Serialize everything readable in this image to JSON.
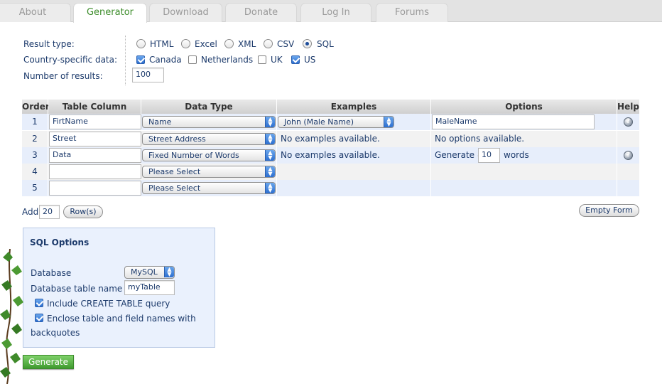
{
  "tabs": [
    "About",
    "Generator",
    "Download",
    "Donate",
    "Log In",
    "Forums"
  ],
  "active_tab": "Generator",
  "settings": {
    "result_type_label": "Result type:",
    "result_types": [
      {
        "label": "HTML",
        "selected": false
      },
      {
        "label": "Excel",
        "selected": false
      },
      {
        "label": "XML",
        "selected": false
      },
      {
        "label": "CSV",
        "selected": false
      },
      {
        "label": "SQL",
        "selected": true
      }
    ],
    "country_label": "Country-specific data:",
    "countries": [
      {
        "label": "Canada",
        "checked": true
      },
      {
        "label": "Netherlands",
        "checked": false
      },
      {
        "label": "UK",
        "checked": false
      },
      {
        "label": "US",
        "checked": true
      }
    ],
    "num_results_label": "Number of results:",
    "num_results": "100"
  },
  "table": {
    "headers": [
      "Order",
      "Table Column",
      "Data Type",
      "Examples",
      "Options",
      "Help"
    ],
    "rows": [
      {
        "order": "1",
        "column": "FirtName",
        "data_type": "Name",
        "example_select": "John (Male Name)",
        "options_input": "MaleName",
        "help": true
      },
      {
        "order": "2",
        "column": "Street",
        "data_type": "Street Address",
        "examples_text": "No examples available.",
        "options_text": "No options available.",
        "help": false
      },
      {
        "order": "3",
        "column": "Data",
        "data_type": "Fixed Number of Words",
        "examples_text": "No examples available.",
        "options_prefix": "Generate #",
        "options_num": "10",
        "options_suffix": "words",
        "help": true
      },
      {
        "order": "4",
        "column": "",
        "data_type": "Please Select",
        "help": false
      },
      {
        "order": "5",
        "column": "",
        "data_type": "Please Select",
        "help": false
      }
    ]
  },
  "add_rows": {
    "label": "Add",
    "count": "20",
    "button": "Row(s)"
  },
  "empty_form_button": "Empty Form",
  "sql_options": {
    "title": "SQL Options",
    "database_label": "Database",
    "database_value": "MySQL",
    "table_name_label": "Database table name",
    "table_name_value": "myTable",
    "include_create": {
      "label": "Include CREATE TABLE query",
      "checked": true
    },
    "enclose_quotes": {
      "label_line1": "Enclose table and field names with",
      "label_line2": "backquotes",
      "checked": true
    }
  },
  "generate_button": "Generate",
  "colors": {
    "accent_green": "#3c8c2a",
    "text_blue": "#1c3a6b",
    "row_alt": "#e7eefb",
    "panel_bg": "#eaf1fd"
  }
}
